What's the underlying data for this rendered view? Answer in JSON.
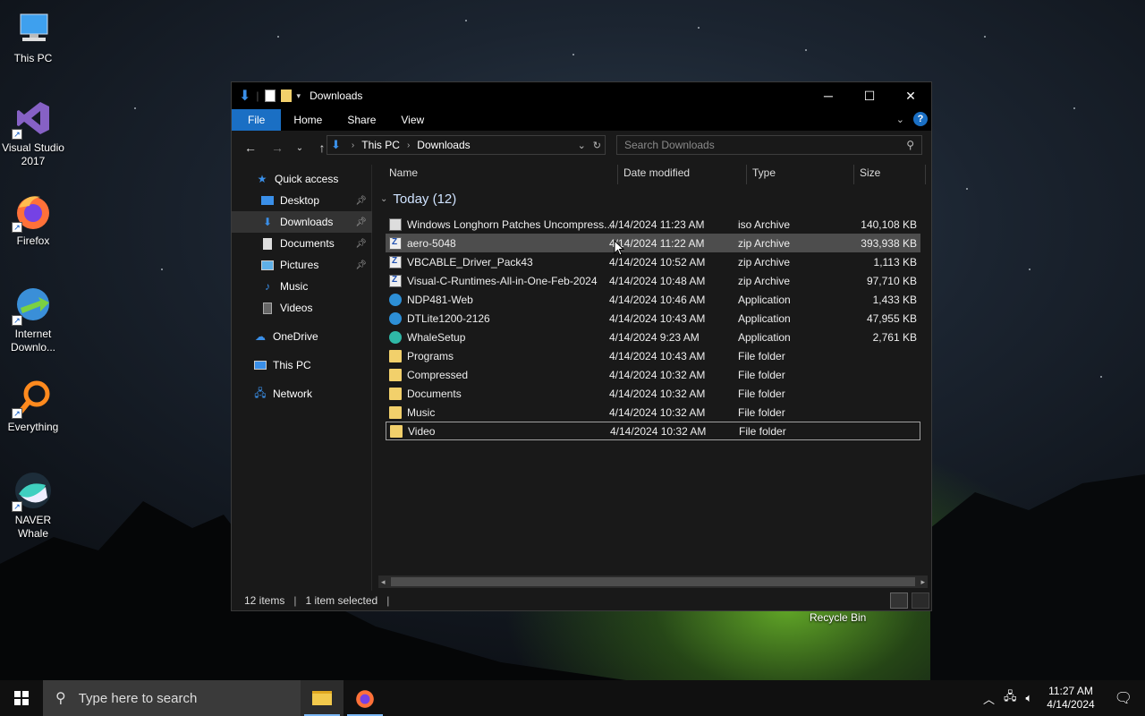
{
  "desktop": {
    "icons": [
      {
        "label_line1": "This PC",
        "label_line2": "",
        "icon": "computer-icon"
      },
      {
        "label_line1": "Visual Studio",
        "label_line2": "2017",
        "icon": "visual-studio-icon"
      },
      {
        "label_line1": "Firefox",
        "label_line2": "",
        "icon": "firefox-icon"
      },
      {
        "label_line1": "Internet",
        "label_line2": "Downlo...",
        "icon": "internet-download-manager-icon"
      },
      {
        "label_line1": "Everything",
        "label_line2": "",
        "icon": "everything-search-icon"
      },
      {
        "label_line1": "NAVER",
        "label_line2": "Whale",
        "icon": "naver-whale-icon"
      }
    ],
    "recycle_bin": "Recycle Bin"
  },
  "window": {
    "title": "Downloads",
    "ribbon_tabs": [
      "File",
      "Home",
      "Share",
      "View"
    ],
    "help": "?",
    "address": {
      "root": "This PC",
      "current": "Downloads"
    },
    "search_placeholder": "Search Downloads"
  },
  "navpane": {
    "quick_access": "Quick access",
    "items": [
      {
        "label": "Desktop",
        "pinned": true
      },
      {
        "label": "Downloads",
        "pinned": true,
        "selected": true
      },
      {
        "label": "Documents",
        "pinned": true
      },
      {
        "label": "Pictures",
        "pinned": true
      },
      {
        "label": "Music",
        "pinned": false
      },
      {
        "label": "Videos",
        "pinned": false
      }
    ],
    "onedrive": "OneDrive",
    "this_pc": "This PC",
    "network": "Network"
  },
  "columns": {
    "name": "Name",
    "date": "Date modified",
    "type": "Type",
    "size": "Size"
  },
  "group": {
    "label": "Today (12)"
  },
  "files": [
    {
      "name": "Windows Longhorn Patches Uncompress...",
      "date": "4/14/2024 11:23 AM",
      "type": "iso Archive",
      "size": "140,108 KB",
      "kind": "iso"
    },
    {
      "name": "aero-5048",
      "date": "4/14/2024 11:22 AM",
      "type": "zip Archive",
      "size": "393,938 KB",
      "kind": "zip"
    },
    {
      "name": "VBCABLE_Driver_Pack43",
      "date": "4/14/2024 10:52 AM",
      "type": "zip Archive",
      "size": "1,113 KB",
      "kind": "zip"
    },
    {
      "name": "Visual-C-Runtimes-All-in-One-Feb-2024",
      "date": "4/14/2024 10:48 AM",
      "type": "zip Archive",
      "size": "97,710 KB",
      "kind": "zip"
    },
    {
      "name": "NDP481-Web",
      "date": "4/14/2024 10:46 AM",
      "type": "Application",
      "size": "1,433 KB",
      "kind": "app"
    },
    {
      "name": "DTLite1200-2126",
      "date": "4/14/2024 10:43 AM",
      "type": "Application",
      "size": "47,955 KB",
      "kind": "app"
    },
    {
      "name": "WhaleSetup",
      "date": "4/14/2024 9:23 AM",
      "type": "Application",
      "size": "2,761 KB",
      "kind": "whale"
    },
    {
      "name": "Programs",
      "date": "4/14/2024 10:43 AM",
      "type": "File folder",
      "size": "",
      "kind": "folder"
    },
    {
      "name": "Compressed",
      "date": "4/14/2024 10:32 AM",
      "type": "File folder",
      "size": "",
      "kind": "folder"
    },
    {
      "name": "Documents",
      "date": "4/14/2024 10:32 AM",
      "type": "File folder",
      "size": "",
      "kind": "folder"
    },
    {
      "name": "Music",
      "date": "4/14/2024 10:32 AM",
      "type": "File folder",
      "size": "",
      "kind": "folder"
    },
    {
      "name": "Video",
      "date": "4/14/2024 10:32 AM",
      "type": "File folder",
      "size": "",
      "kind": "folder"
    }
  ],
  "status": {
    "count": "12 items",
    "selection": "1 item selected"
  },
  "taskbar": {
    "search_placeholder": "Type here to search",
    "time": "11:27 AM",
    "date": "4/14/2024"
  }
}
